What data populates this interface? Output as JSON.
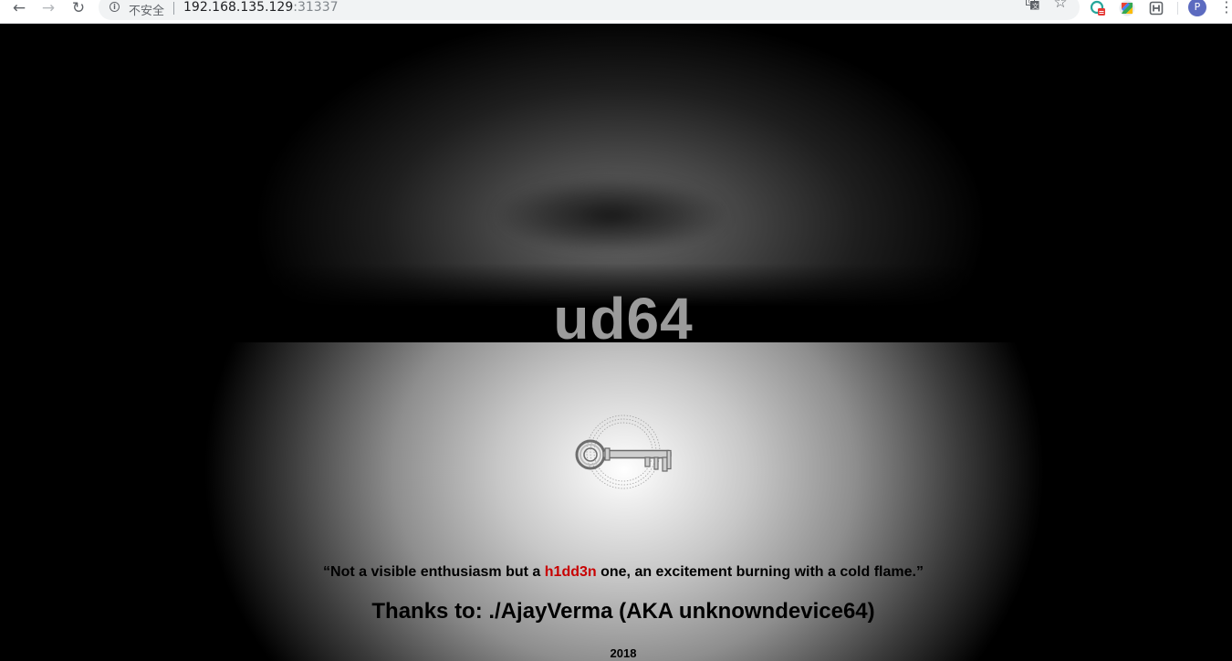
{
  "browser": {
    "address": {
      "security_label": "不安全",
      "host": "192.168.135.129",
      "port": ":31337"
    },
    "icons": {
      "back": "back-arrow-icon",
      "forward": "forward-arrow-icon",
      "reload": "reload-icon",
      "info": "info-icon",
      "translate": "translate-icon",
      "bookmark": "star-icon",
      "extensions": [
        "extension-icon-blue",
        "extension-icon-colorful",
        "extension-icon-h"
      ],
      "menu": "more-vert-icon"
    },
    "profile_initial": "P"
  },
  "page": {
    "title": "ud64",
    "quote_before": "“Not a visible enthusiasm but a ",
    "quote_highlight": "h1dd3n",
    "quote_after": " one, an excitement burning with a cold flame.”",
    "thanks": "Thanks to: ./AjayVerma (AKA unknowndevice64)",
    "year": "2018",
    "highlight_color": "#c80000",
    "title_color": "#9b9b9b"
  }
}
